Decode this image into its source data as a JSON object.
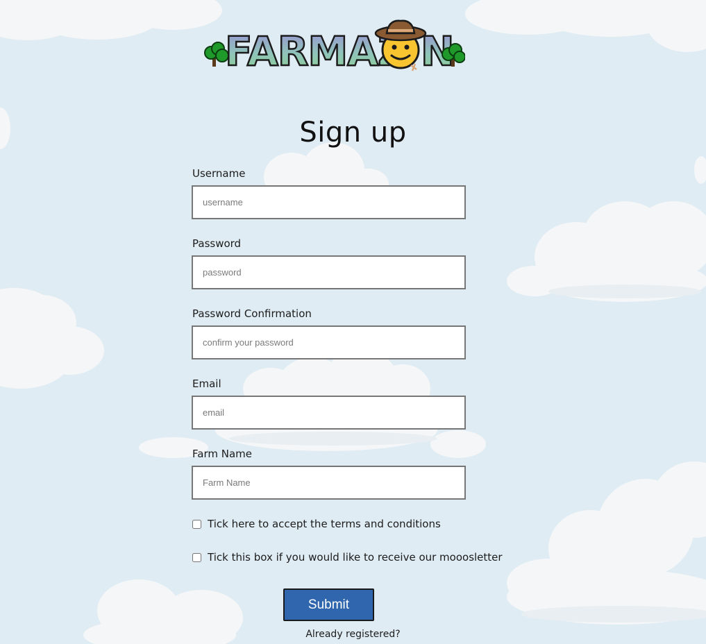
{
  "brand": {
    "logo_text": "FARMAZ☺N",
    "logo_icon": "cowboy-smiley-icon"
  },
  "form": {
    "title": "Sign up",
    "fields": [
      {
        "label": "Username",
        "placeholder": "username"
      },
      {
        "label": "Password",
        "placeholder": "password"
      },
      {
        "label": "Password Confirmation",
        "placeholder": "confirm your password"
      },
      {
        "label": "Email",
        "placeholder": "email"
      },
      {
        "label": "Farm Name",
        "placeholder": "Farm Name"
      }
    ],
    "checkboxes": [
      {
        "label": "Tick here to accept the terms and conditions",
        "checked": false
      },
      {
        "label": "Tick this box if you would like to receive our mooosletter",
        "checked": false
      }
    ],
    "submit_label": "Submit",
    "already_registered": "Already registered?"
  },
  "colors": {
    "background": "#dfecf4",
    "submit_button": "#2f66ad",
    "cloud": "#f5f6f7"
  }
}
